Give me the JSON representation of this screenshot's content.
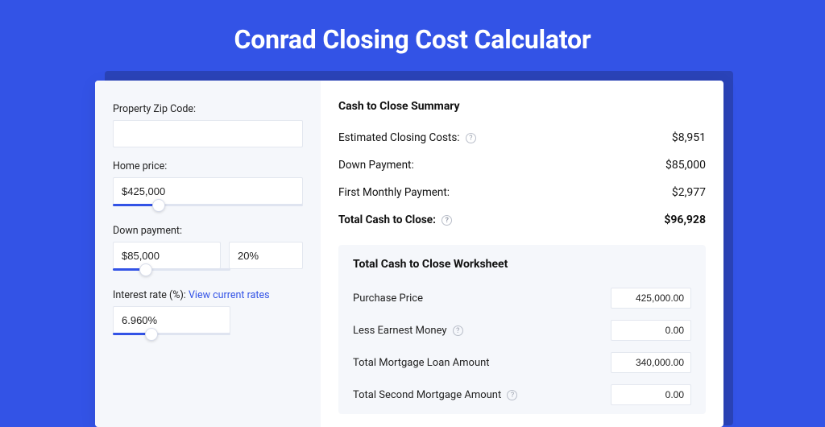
{
  "hero": {
    "title": "Conrad Closing Cost Calculator"
  },
  "left": {
    "zip_label": "Property Zip Code:",
    "zip_value": "",
    "home_price_label": "Home price:",
    "home_price_value": "$425,000",
    "down_payment_label": "Down payment:",
    "down_payment_value": "$85,000",
    "down_payment_pct": "20%",
    "interest_label": "Interest rate (%):",
    "interest_link": "View current rates",
    "interest_value": "6.960%",
    "sliders": {
      "home_price_pct": 24,
      "down_payment_pct": 28,
      "interest_pct": 33
    }
  },
  "summary": {
    "title": "Cash to Close Summary",
    "rows": [
      {
        "label": "Estimated Closing Costs:",
        "help": true,
        "value": "$8,951"
      },
      {
        "label": "Down Payment:",
        "help": false,
        "value": "$85,000"
      },
      {
        "label": "First Monthly Payment:",
        "help": false,
        "value": "$2,977"
      }
    ],
    "total": {
      "label": "Total Cash to Close:",
      "help": true,
      "value": "$96,928"
    }
  },
  "worksheet": {
    "title": "Total Cash to Close Worksheet",
    "rows": [
      {
        "label": "Purchase Price",
        "help": false,
        "value": "425,000.00"
      },
      {
        "label": "Less Earnest Money",
        "help": true,
        "value": "0.00"
      },
      {
        "label": "Total Mortgage Loan Amount",
        "help": false,
        "value": "340,000.00"
      },
      {
        "label": "Total Second Mortgage Amount",
        "help": true,
        "value": "0.00"
      }
    ]
  }
}
